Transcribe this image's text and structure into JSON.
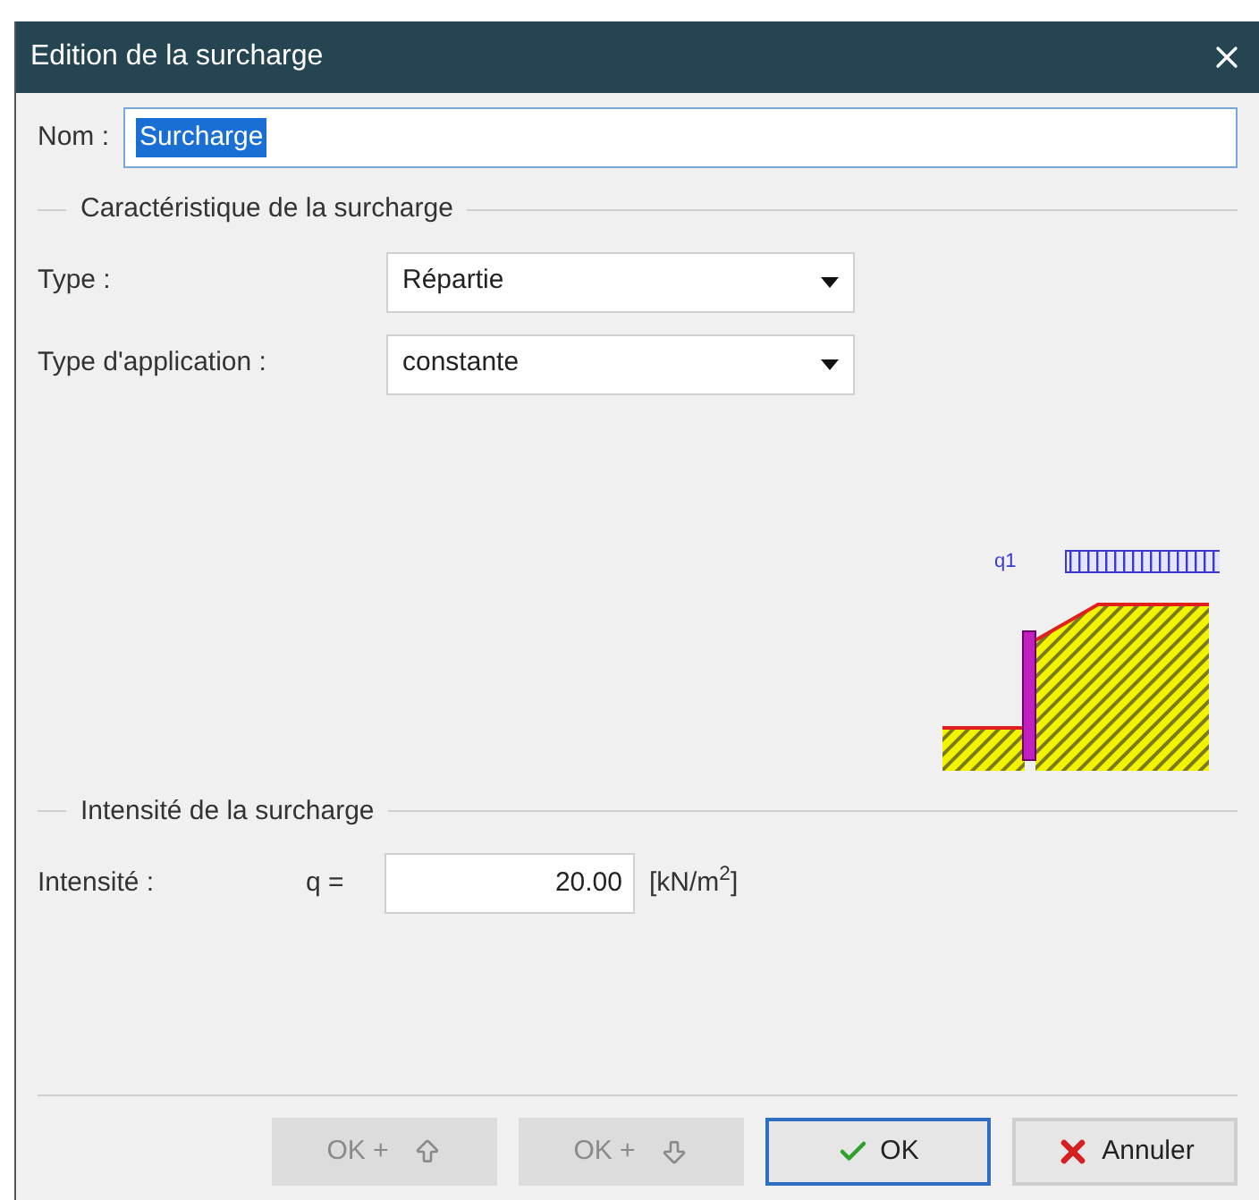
{
  "window": {
    "title": "Edition de la surcharge"
  },
  "name_field": {
    "label": "Nom :",
    "value": "Surcharge",
    "selected": true
  },
  "characteristics": {
    "title": "Caractéristique de la surcharge",
    "fields": [
      {
        "label": "Type :",
        "value": "Répartie"
      },
      {
        "label": "Type d'application :",
        "value": "constante"
      }
    ],
    "diagram": {
      "load_label": "q1"
    }
  },
  "intensity": {
    "title": "Intensité de la surcharge",
    "label": "Intensité :",
    "symbol": "q =",
    "value": "20.00",
    "unit": "[kN/m$^{2}$]"
  },
  "buttons": [
    {
      "kind": "ok_up",
      "label": "OK +",
      "disabled": true,
      "focused": false
    },
    {
      "kind": "ok_down",
      "label": "OK +",
      "disabled": true,
      "focused": false
    },
    {
      "kind": "ok",
      "label": "OK",
      "disabled": false,
      "focused": true
    },
    {
      "kind": "cancel",
      "label": "Annuler",
      "disabled": false,
      "focused": false
    }
  ]
}
